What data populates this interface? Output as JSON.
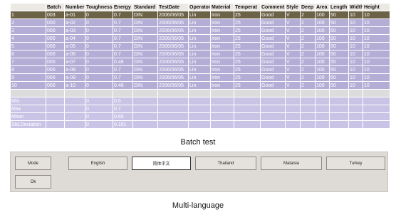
{
  "table": {
    "columns": [
      "",
      "Batch",
      "Number",
      "Toughness",
      "Energy",
      "Standard",
      "TestDate",
      "Operator",
      "Material",
      "Temperat",
      "Comment",
      "Style",
      "Deep",
      "Area",
      "Length",
      "Width",
      "Height"
    ],
    "rows": [
      [
        "1",
        "003",
        "a-01",
        "0",
        "0.7",
        "DIN",
        "2006/06/05",
        "Lin",
        "Iron",
        "25",
        "Good",
        "V",
        "2",
        "100",
        "50",
        "10",
        "10"
      ],
      [
        "2",
        "000",
        "a-02",
        "0",
        "0.7",
        "DIN",
        "2006/06/05",
        "Lin",
        "Iron",
        "25",
        "Good",
        "V",
        "2",
        "100",
        "50",
        "10",
        "10"
      ],
      [
        "3",
        "000",
        "a-03",
        "0",
        "0.7",
        "DIN",
        "2006/06/05",
        "Lin",
        "Iron",
        "25",
        "Good",
        "V",
        "2",
        "100",
        "50",
        "10",
        "10"
      ],
      [
        "4",
        "000",
        "a-04",
        "0",
        "0.7",
        "DIN",
        "2006/06/05",
        "Lin",
        "Iron",
        "25",
        "Good",
        "V",
        "2",
        "100",
        "50",
        "10",
        "10"
      ],
      [
        "5",
        "000",
        "a-05",
        "0",
        "0.7",
        "DIN",
        "2006/06/05",
        "Lin",
        "Iron",
        "25",
        "Good",
        "V",
        "2",
        "100",
        "50",
        "10",
        "10"
      ],
      [
        "6",
        "000",
        "a-06",
        "0",
        "0.7",
        "DIN",
        "2006/06/05",
        "Lin",
        "Iron",
        "25",
        "Good",
        "V",
        "2",
        "100",
        "50",
        "10",
        "10"
      ],
      [
        "7",
        "000",
        "a-07",
        "0",
        "0.46",
        "DIN",
        "2006/06/05",
        "Lin",
        "Iron",
        "25",
        "Good",
        "V",
        "2",
        "100",
        "50",
        "10",
        "10"
      ],
      [
        "8",
        "000",
        "a-08",
        "0",
        "0.7",
        "DIN",
        "2006/06/05",
        "Lin",
        "Iron",
        "25",
        "Good",
        "V",
        "2",
        "100",
        "50",
        "10",
        "10"
      ],
      [
        "9",
        "000",
        "a-09",
        "0",
        "0.7",
        "DIN",
        "2006/06/05",
        "Lin",
        "Iron",
        "25",
        "Good",
        "V",
        "2",
        "100",
        "50",
        "10",
        "10"
      ],
      [
        "10",
        "000",
        "a-10",
        "0",
        "0.46",
        "DIN",
        "2006/06/05",
        "Lin",
        "Iron",
        "25",
        "Good",
        "V",
        "2",
        "100",
        "50",
        "10",
        "10"
      ]
    ],
    "selected_row": 0,
    "stats": [
      [
        "Min",
        "",
        "",
        "0",
        "0.5"
      ],
      [
        "Max",
        "",
        "",
        "0",
        "0.7"
      ],
      [
        "Mean",
        "",
        "",
        "0",
        "0.65"
      ],
      [
        "Std.Deviation",
        "",
        "",
        "0",
        "0.101"
      ]
    ]
  },
  "captions": {
    "batch_test": "Batch test",
    "multi_language": "Multi-language"
  },
  "buttons": {
    "mode": "Mode",
    "ok": "Ok",
    "languages": [
      "English",
      "简体中文",
      "Thailand",
      "Malaisia",
      "Turkey"
    ],
    "active_language": "简体中文"
  },
  "colors": {
    "row_bg": "#b4aed7",
    "selected_row_bg": "#6c6247",
    "stats_bg": "#c9c4e6",
    "header_bg": "#ece9e4"
  }
}
